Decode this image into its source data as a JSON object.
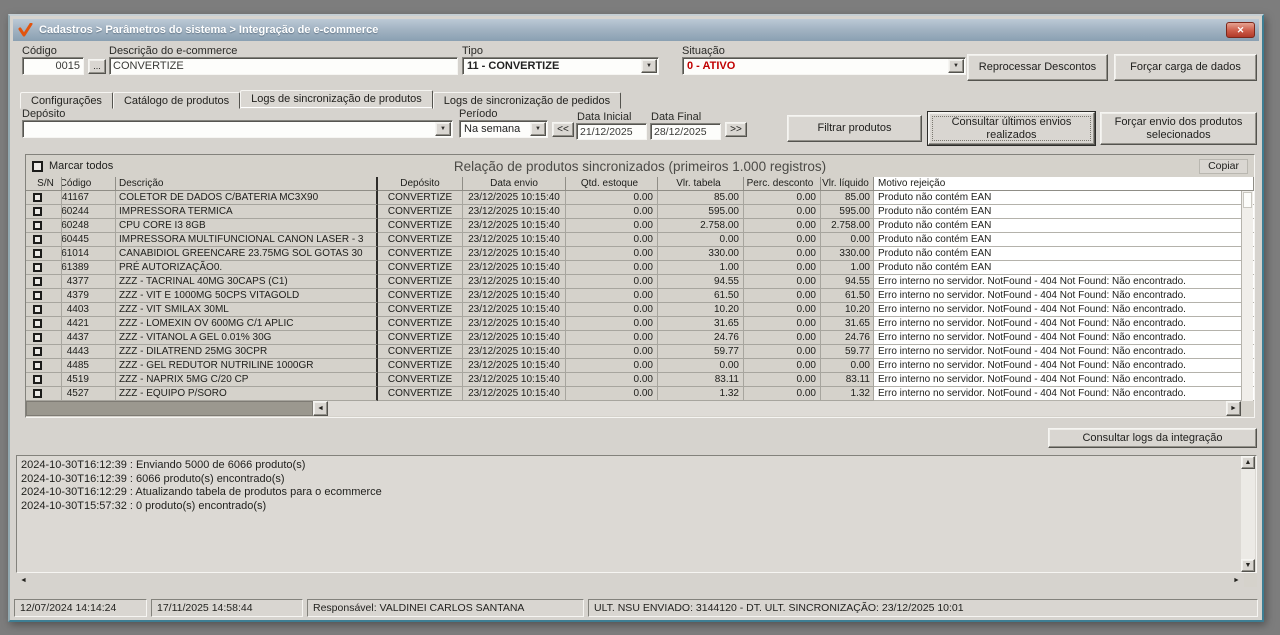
{
  "colors": {
    "situacao_active": "#c00000",
    "close_button": "#b03a2a",
    "titlebar_top": "#bcc9d6",
    "titlebar_bottom": "#8aa0b2"
  },
  "icons": {
    "chevron_down": "▼",
    "scroll_left": "◄",
    "scroll_right": "►",
    "scroll_up": "▲",
    "scroll_down": "▼",
    "close": "✕"
  },
  "window": {
    "title": "Cadastros > Parâmetros do sistema > Integração de e-commerce"
  },
  "form": {
    "codigo_label": "Código",
    "codigo_value": "0015",
    "codigo_browse": "...",
    "descricao_label": "Descrição do e-commerce",
    "descricao_value": "CONVERTIZE",
    "tipo_label": "Tipo",
    "tipo_value": "11 - CONVERTIZE",
    "situacao_label": "Situação",
    "situacao_value": "0 - ATIVO",
    "reprocessar_label": "Reprocessar Descontos",
    "forcar_carga_label": "Forçar carga de dados"
  },
  "tabs": [
    {
      "label": "Configurações",
      "active": false
    },
    {
      "label": "Catálogo de produtos",
      "active": false
    },
    {
      "label": "Logs de sincronização de produtos",
      "active": true
    },
    {
      "label": "Logs de sincronização de pedidos",
      "active": false
    }
  ],
  "filter": {
    "deposito_label": "Depósito",
    "deposito_value": "",
    "periodo_label": "Período",
    "periodo_value": "Na semana",
    "prev_label": "<<",
    "data_inicial_label": "Data Inicial",
    "data_inicial_value": "21/12/2025",
    "data_final_label": "Data Final",
    "data_final_value": "28/12/2025",
    "next_label": ">>",
    "filtrar_label": "Filtrar produtos",
    "consultar_label": "Consultar últimos envios realizados",
    "forcar_envio_label": "Forçar envio dos produtos selecionados"
  },
  "grid": {
    "marcar_todos_label": "Marcar todos",
    "title": "Relação de produtos sincronizados (primeiros 1.000 registros)",
    "copiar_label": "Copiar",
    "columns": [
      "S/N",
      "Código",
      "Descrição",
      "Depósito",
      "Data envio",
      "Qtd. estoque",
      "Vlr. tabela",
      "Perc. desconto",
      "Vlr. líquido",
      "Motivo rejeição"
    ],
    "rows": [
      {
        "codigo": "41167",
        "descricao": "COLETOR DE DADOS C/BATERIA MC3X90",
        "deposito": "CONVERTIZE",
        "data_envio": "23/12/2025 10:15:40",
        "qtd_estoque": "0.00",
        "vlr_tabela": "85.00",
        "perc_desconto": "0.00",
        "vlr_liquido": "85.00",
        "motivo": "Produto não contém EAN"
      },
      {
        "codigo": "60244",
        "descricao": "IMPRESSORA TERMICA",
        "deposito": "CONVERTIZE",
        "data_envio": "23/12/2025 10:15:40",
        "qtd_estoque": "0.00",
        "vlr_tabela": "595.00",
        "perc_desconto": "0.00",
        "vlr_liquido": "595.00",
        "motivo": "Produto não contém EAN"
      },
      {
        "codigo": "60248",
        "descricao": "CPU CORE I3 8GB",
        "deposito": "CONVERTIZE",
        "data_envio": "23/12/2025 10:15:40",
        "qtd_estoque": "0.00",
        "vlr_tabela": "2.758.00",
        "perc_desconto": "0.00",
        "vlr_liquido": "2.758.00",
        "motivo": "Produto não contém EAN"
      },
      {
        "codigo": "60445",
        "descricao": "IMPRESSORA MULTIFUNCIONAL CANON LASER - 3",
        "deposito": "CONVERTIZE",
        "data_envio": "23/12/2025 10:15:40",
        "qtd_estoque": "0.00",
        "vlr_tabela": "0.00",
        "perc_desconto": "0.00",
        "vlr_liquido": "0.00",
        "motivo": "Produto não contém EAN"
      },
      {
        "codigo": "61014",
        "descricao": "CANABIDIOL GREENCARE 23.75MG SOL GOTAS 30",
        "deposito": "CONVERTIZE",
        "data_envio": "23/12/2025 10:15:40",
        "qtd_estoque": "0.00",
        "vlr_tabela": "330.00",
        "perc_desconto": "0.00",
        "vlr_liquido": "330.00",
        "motivo": "Produto não contém EAN"
      },
      {
        "codigo": "61389",
        "descricao": "PRÉ AUTORIZAÇÃO0.",
        "deposito": "CONVERTIZE",
        "data_envio": "23/12/2025 10:15:40",
        "qtd_estoque": "0.00",
        "vlr_tabela": "1.00",
        "perc_desconto": "0.00",
        "vlr_liquido": "1.00",
        "motivo": "Produto não contém EAN"
      },
      {
        "codigo": "4377",
        "descricao": "ZZZ - TACRINAL 40MG 30CAPS (C1)",
        "deposito": "CONVERTIZE",
        "data_envio": "23/12/2025 10:15:40",
        "qtd_estoque": "0.00",
        "vlr_tabela": "94.55",
        "perc_desconto": "0.00",
        "vlr_liquido": "94.55",
        "motivo": "Erro interno no servidor. NotFound - 404 Not Found: Não encontrado."
      },
      {
        "codigo": "4379",
        "descricao": "ZZZ - VIT E 1000MG 50CPS VITAGOLD",
        "deposito": "CONVERTIZE",
        "data_envio": "23/12/2025 10:15:40",
        "qtd_estoque": "0.00",
        "vlr_tabela": "61.50",
        "perc_desconto": "0.00",
        "vlr_liquido": "61.50",
        "motivo": "Erro interno no servidor. NotFound - 404 Not Found: Não encontrado."
      },
      {
        "codigo": "4403",
        "descricao": "ZZZ - VIT SMILAX 30ML",
        "deposito": "CONVERTIZE",
        "data_envio": "23/12/2025 10:15:40",
        "qtd_estoque": "0.00",
        "vlr_tabela": "10.20",
        "perc_desconto": "0.00",
        "vlr_liquido": "10.20",
        "motivo": "Erro interno no servidor. NotFound - 404 Not Found: Não encontrado."
      },
      {
        "codigo": "4421",
        "descricao": "ZZZ - LOMEXIN OV 600MG C/1 APLIC",
        "deposito": "CONVERTIZE",
        "data_envio": "23/12/2025 10:15:40",
        "qtd_estoque": "0.00",
        "vlr_tabela": "31.65",
        "perc_desconto": "0.00",
        "vlr_liquido": "31.65",
        "motivo": "Erro interno no servidor. NotFound - 404 Not Found: Não encontrado."
      },
      {
        "codigo": "4437",
        "descricao": "ZZZ - VITANOL A GEL 0.01% 30G",
        "deposito": "CONVERTIZE",
        "data_envio": "23/12/2025 10:15:40",
        "qtd_estoque": "0.00",
        "vlr_tabela": "24.76",
        "perc_desconto": "0.00",
        "vlr_liquido": "24.76",
        "motivo": "Erro interno no servidor. NotFound - 404 Not Found: Não encontrado."
      },
      {
        "codigo": "4443",
        "descricao": "ZZZ - DILATREND 25MG 30CPR",
        "deposito": "CONVERTIZE",
        "data_envio": "23/12/2025 10:15:40",
        "qtd_estoque": "0.00",
        "vlr_tabela": "59.77",
        "perc_desconto": "0.00",
        "vlr_liquido": "59.77",
        "motivo": "Erro interno no servidor. NotFound - 404 Not Found: Não encontrado."
      },
      {
        "codigo": "4485",
        "descricao": "ZZZ - GEL REDUTOR NUTRILINE 1000GR",
        "deposito": "CONVERTIZE",
        "data_envio": "23/12/2025 10:15:40",
        "qtd_estoque": "0.00",
        "vlr_tabela": "0.00",
        "perc_desconto": "0.00",
        "vlr_liquido": "0.00",
        "motivo": "Erro interno no servidor. NotFound - 404 Not Found: Não encontrado."
      },
      {
        "codigo": "4519",
        "descricao": "ZZZ - NAPRIX 5MG C/20 CP",
        "deposito": "CONVERTIZE",
        "data_envio": "23/12/2025 10:15:40",
        "qtd_estoque": "0.00",
        "vlr_tabela": "83.11",
        "perc_desconto": "0.00",
        "vlr_liquido": "83.11",
        "motivo": "Erro interno no servidor. NotFound - 404 Not Found: Não encontrado."
      },
      {
        "codigo": "4527",
        "descricao": "ZZZ - EQUIPO P/SORO",
        "deposito": "CONVERTIZE",
        "data_envio": "23/12/2025 10:15:40",
        "qtd_estoque": "0.00",
        "vlr_tabela": "1.32",
        "perc_desconto": "0.00",
        "vlr_liquido": "1.32",
        "motivo": "Erro interno no servidor. NotFound - 404 Not Found: Não encontrado."
      }
    ]
  },
  "integration": {
    "consultar_logs_label": "Consultar logs da integração"
  },
  "log": {
    "lines": [
      "2024-10-30T16:12:39 : Enviando 5000 de 6066 produto(s)",
      "2024-10-30T16:12:39 : 6066 produto(s) encontrado(s)",
      "2024-10-30T16:12:29 : Atualizando tabela de produtos para o ecommerce",
      "2024-10-30T15:57:32 : 0 produto(s) encontrado(s)"
    ]
  },
  "status_bar": {
    "created_at": "12/07/2024 14:14:24",
    "updated_at": "17/11/2025 14:58:44",
    "responsavel": "Responsável: VALDINEI CARLOS SANTANA",
    "nsu_info": "ULT. NSU ENVIADO: 3144120 - DT. ULT. SINCRONIZAÇÃO: 23/12/2025 10:01"
  }
}
